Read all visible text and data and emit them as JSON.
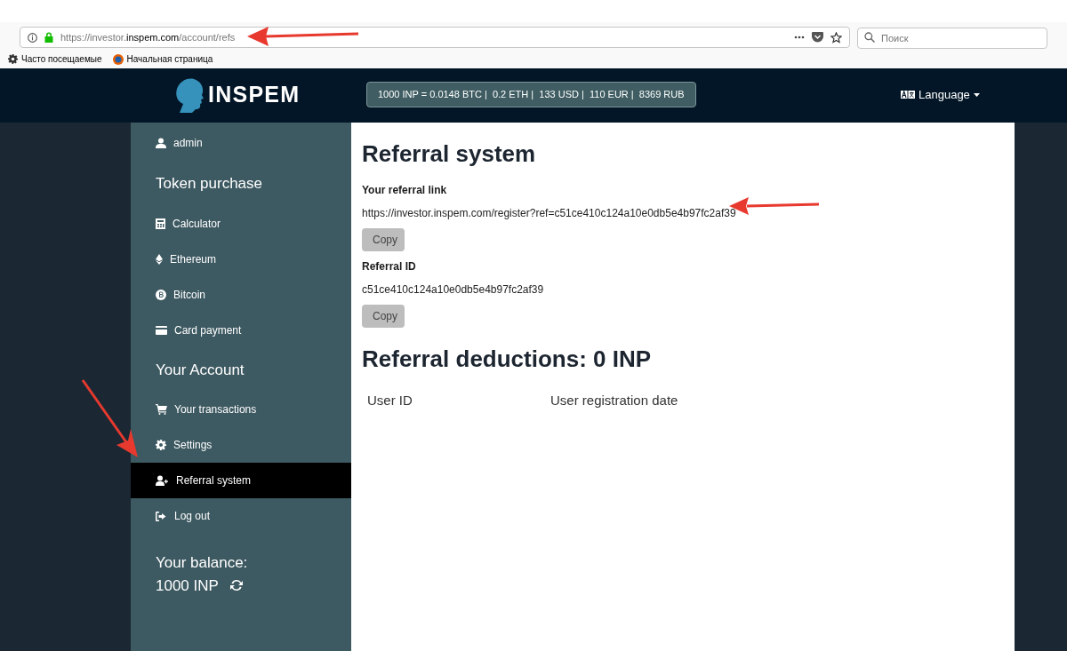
{
  "browser": {
    "url_prefix": "https://investor.",
    "url_domain": "inspem.com",
    "url_path": "/account/refs",
    "search_placeholder": "Поиск",
    "bookmarks": [
      {
        "kind": "gear",
        "label": "Часто посещаемые"
      },
      {
        "kind": "browser",
        "label": "Начальная страница"
      }
    ]
  },
  "header": {
    "logo": "INSPEM",
    "rates": "1000 INP = 0.0148 BTC |  0.2 ETH |  133 USD |  110 EUR |  8369 RUB",
    "language": "Language"
  },
  "sidebar": {
    "items": [
      {
        "kind": "user",
        "label": "admin",
        "selected": false
      },
      {
        "kind": "heading",
        "label": "Token purchase"
      },
      {
        "kind": "calculator",
        "label": "Calculator",
        "selected": false
      },
      {
        "kind": "ethereum",
        "label": "Ethereum",
        "selected": false
      },
      {
        "kind": "bitcoin",
        "label": "Bitcoin",
        "selected": false
      },
      {
        "kind": "card",
        "label": "Card payment",
        "selected": false
      },
      {
        "kind": "heading",
        "label": "Your Account"
      },
      {
        "kind": "cart",
        "label": "Your transactions",
        "selected": false
      },
      {
        "kind": "gear",
        "label": "Settings",
        "selected": false
      },
      {
        "kind": "user-plus",
        "label": "Referral system",
        "selected": true
      },
      {
        "kind": "logout",
        "label": "Log out",
        "selected": false
      }
    ],
    "balance_label": "Your balance:",
    "balance_value": "1000 INP"
  },
  "content": {
    "title": "Referral system",
    "fields": [
      {
        "label": "Your referral link",
        "value": "https://investor.inspem.com/register?ref=c51ce410c124a10e0db5e4b97fc2af39",
        "button": "Copy"
      },
      {
        "label": "Referral ID",
        "value": "c51ce410c124a10e0db5e4b97fc2af39",
        "button": "Copy"
      }
    ],
    "deductions_title": "Referral deductions: 0 INP",
    "table": {
      "columns": [
        "User ID",
        "User registration date"
      ]
    }
  }
}
